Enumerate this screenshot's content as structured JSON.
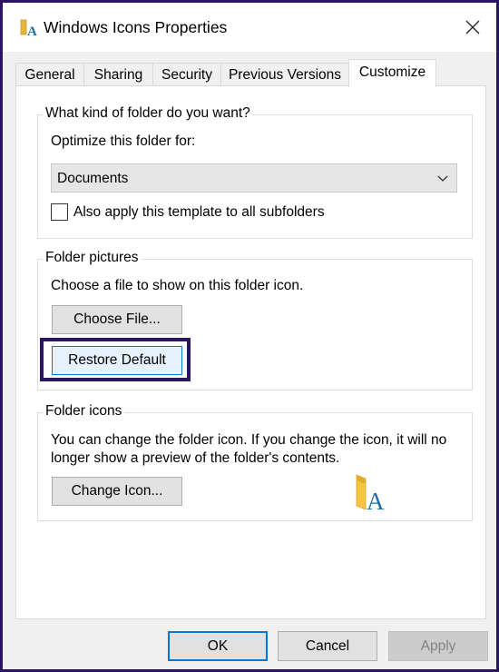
{
  "window": {
    "title": "Windows Icons Properties",
    "close_label": "✕"
  },
  "tabs": [
    {
      "label": "General"
    },
    {
      "label": "Sharing"
    },
    {
      "label": "Security"
    },
    {
      "label": "Previous Versions"
    },
    {
      "label": "Customize"
    }
  ],
  "active_tab": "Customize",
  "folder_type": {
    "group_title": "What kind of folder do you want?",
    "optimize_label": "Optimize this folder for:",
    "selected": "Documents",
    "apply_subfolders_label": "Also apply this template to all subfolders",
    "apply_subfolders_checked": false
  },
  "folder_pictures": {
    "group_title": "Folder pictures",
    "description": "Choose a file to show on this folder icon.",
    "choose_file_label": "Choose File...",
    "restore_default_label": "Restore Default"
  },
  "folder_icons": {
    "group_title": "Folder icons",
    "description_line1": "You can change the folder icon. If you change the icon, it will no",
    "description_line2": "longer show a preview of the folder's contents.",
    "change_icon_label": "Change Icon...",
    "preview_icon": "folder-with-a-icon"
  },
  "footer": {
    "ok_label": "OK",
    "cancel_label": "Cancel",
    "apply_label": "Apply"
  },
  "colors": {
    "frame": "#2a1660",
    "accent": "#0078d7",
    "folder_yellow": "#f5c542",
    "letter_blue": "#1b6ea8"
  }
}
